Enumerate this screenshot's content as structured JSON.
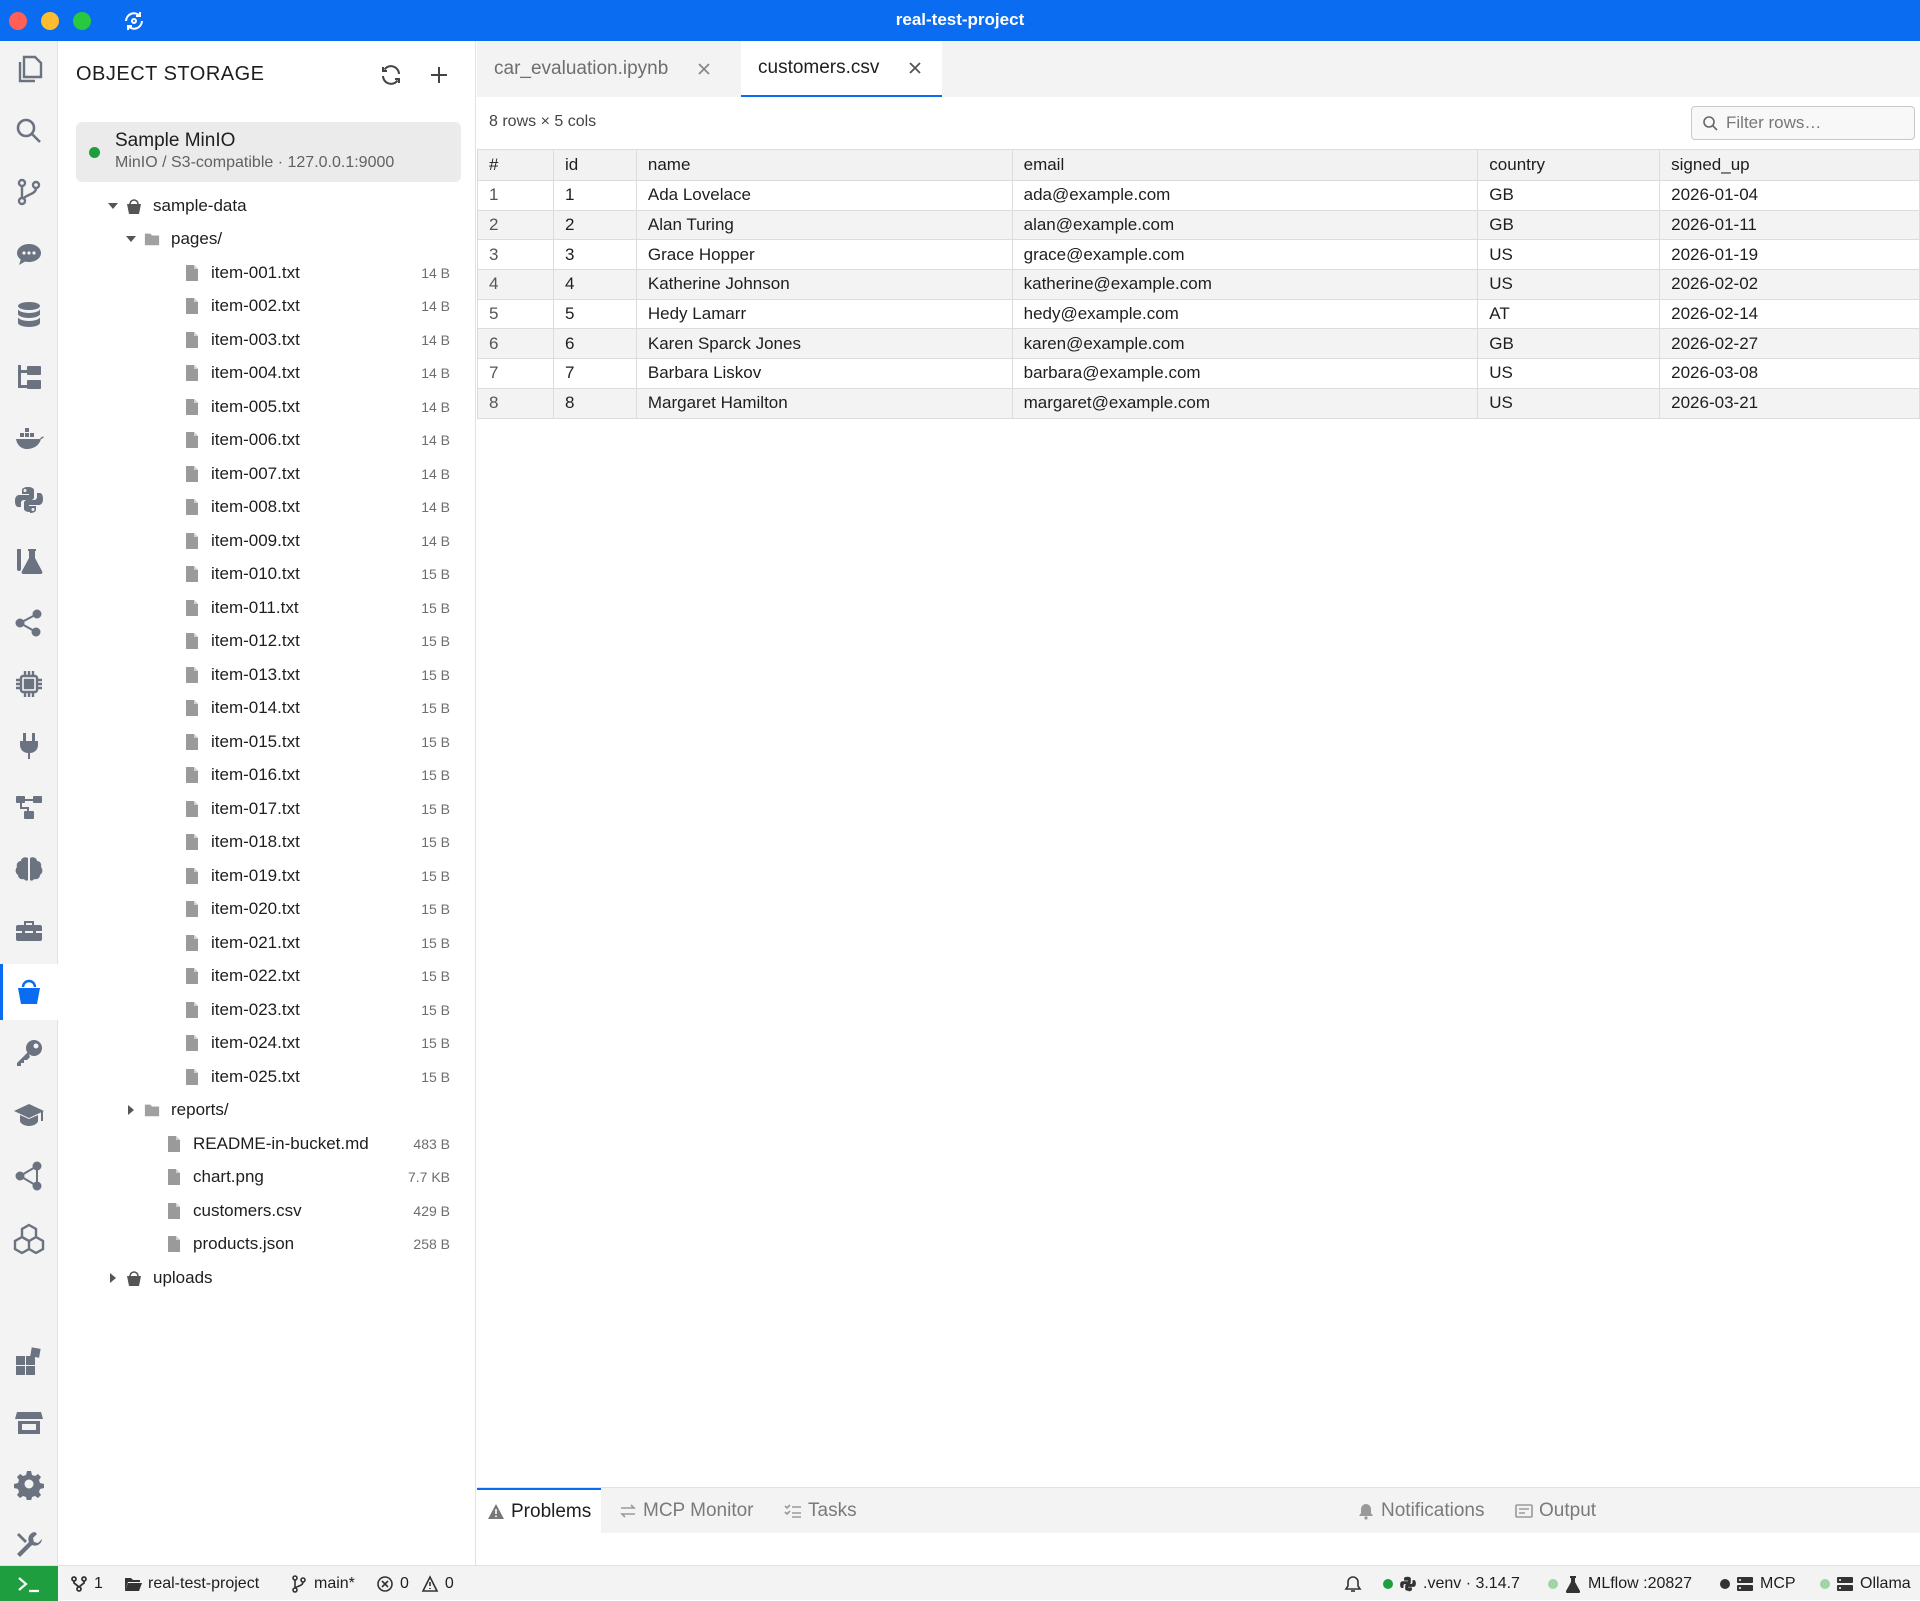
{
  "window": {
    "title": "real-test-project"
  },
  "sidebar": {
    "title": "OBJECT STORAGE",
    "connection": {
      "name": "Sample MinIO",
      "subtitle": "MinIO / S3-compatible · 127.0.0.1:9000",
      "status_color": "#1e9e3e"
    },
    "tree": [
      {
        "name": "sample-data",
        "kind": "bucket",
        "depth": 0,
        "expanded": true
      },
      {
        "name": "pages/",
        "kind": "folder",
        "depth": 1,
        "expanded": true
      },
      {
        "name": "item-001.txt",
        "kind": "file",
        "depth": 2,
        "size": "14 B"
      },
      {
        "name": "item-002.txt",
        "kind": "file",
        "depth": 2,
        "size": "14 B"
      },
      {
        "name": "item-003.txt",
        "kind": "file",
        "depth": 2,
        "size": "14 B"
      },
      {
        "name": "item-004.txt",
        "kind": "file",
        "depth": 2,
        "size": "14 B"
      },
      {
        "name": "item-005.txt",
        "kind": "file",
        "depth": 2,
        "size": "14 B"
      },
      {
        "name": "item-006.txt",
        "kind": "file",
        "depth": 2,
        "size": "14 B"
      },
      {
        "name": "item-007.txt",
        "kind": "file",
        "depth": 2,
        "size": "14 B"
      },
      {
        "name": "item-008.txt",
        "kind": "file",
        "depth": 2,
        "size": "14 B"
      },
      {
        "name": "item-009.txt",
        "kind": "file",
        "depth": 2,
        "size": "14 B"
      },
      {
        "name": "item-010.txt",
        "kind": "file",
        "depth": 2,
        "size": "15 B"
      },
      {
        "name": "item-011.txt",
        "kind": "file",
        "depth": 2,
        "size": "15 B"
      },
      {
        "name": "item-012.txt",
        "kind": "file",
        "depth": 2,
        "size": "15 B"
      },
      {
        "name": "item-013.txt",
        "kind": "file",
        "depth": 2,
        "size": "15 B"
      },
      {
        "name": "item-014.txt",
        "kind": "file",
        "depth": 2,
        "size": "15 B"
      },
      {
        "name": "item-015.txt",
        "kind": "file",
        "depth": 2,
        "size": "15 B"
      },
      {
        "name": "item-016.txt",
        "kind": "file",
        "depth": 2,
        "size": "15 B"
      },
      {
        "name": "item-017.txt",
        "kind": "file",
        "depth": 2,
        "size": "15 B"
      },
      {
        "name": "item-018.txt",
        "kind": "file",
        "depth": 2,
        "size": "15 B"
      },
      {
        "name": "item-019.txt",
        "kind": "file",
        "depth": 2,
        "size": "15 B"
      },
      {
        "name": "item-020.txt",
        "kind": "file",
        "depth": 2,
        "size": "15 B"
      },
      {
        "name": "item-021.txt",
        "kind": "file",
        "depth": 2,
        "size": "15 B"
      },
      {
        "name": "item-022.txt",
        "kind": "file",
        "depth": 2,
        "size": "15 B"
      },
      {
        "name": "item-023.txt",
        "kind": "file",
        "depth": 2,
        "size": "15 B"
      },
      {
        "name": "item-024.txt",
        "kind": "file",
        "depth": 2,
        "size": "15 B"
      },
      {
        "name": "item-025.txt",
        "kind": "file",
        "depth": 2,
        "size": "15 B"
      },
      {
        "name": "reports/",
        "kind": "folder",
        "depth": 1,
        "expanded": false
      },
      {
        "name": "README-in-bucket.md",
        "kind": "file",
        "depth": 1,
        "size": "483 B"
      },
      {
        "name": "chart.png",
        "kind": "file",
        "depth": 1,
        "size": "7.7 KB"
      },
      {
        "name": "customers.csv",
        "kind": "file",
        "depth": 1,
        "size": "429 B"
      },
      {
        "name": "products.json",
        "kind": "file",
        "depth": 1,
        "size": "258 B"
      },
      {
        "name": "uploads",
        "kind": "bucket",
        "depth": 0,
        "expanded": false
      }
    ]
  },
  "tabs": [
    {
      "label": "car_evaluation.ipynb",
      "active": false
    },
    {
      "label": "customers.csv",
      "active": true
    }
  ],
  "editor": {
    "summary": "8 rows × 5 cols",
    "filter_placeholder": "Filter rows…",
    "columns": [
      "#",
      "id",
      "name",
      "email",
      "country",
      "signed_up"
    ],
    "rows": [
      [
        "1",
        "1",
        "Ada Lovelace",
        "ada@example.com",
        "GB",
        "2026-01-04"
      ],
      [
        "2",
        "2",
        "Alan Turing",
        "alan@example.com",
        "GB",
        "2026-01-11"
      ],
      [
        "3",
        "3",
        "Grace Hopper",
        "grace@example.com",
        "US",
        "2026-01-19"
      ],
      [
        "4",
        "4",
        "Katherine Johnson",
        "katherine@example.com",
        "US",
        "2026-02-02"
      ],
      [
        "5",
        "5",
        "Hedy Lamarr",
        "hedy@example.com",
        "AT",
        "2026-02-14"
      ],
      [
        "6",
        "6",
        "Karen Sparck Jones",
        "karen@example.com",
        "GB",
        "2026-02-27"
      ],
      [
        "7",
        "7",
        "Barbara Liskov",
        "barbara@example.com",
        "US",
        "2026-03-08"
      ],
      [
        "8",
        "8",
        "Margaret Hamilton",
        "margaret@example.com",
        "US",
        "2026-03-21"
      ]
    ]
  },
  "panel": {
    "tabs": [
      {
        "label": "Problems",
        "icon": "warning-icon",
        "active": true
      },
      {
        "label": "MCP Monitor",
        "icon": "arrows-icon",
        "active": false
      },
      {
        "label": "Tasks",
        "icon": "tasks-icon",
        "active": false
      },
      {
        "label": "Notifications",
        "icon": "bell-icon",
        "active": false
      },
      {
        "label": "Output",
        "icon": "output-icon",
        "active": false
      }
    ]
  },
  "statusbar": {
    "ports": "1",
    "project": "real-test-project",
    "branch": "main*",
    "errors": "0",
    "warnings": "0",
    "python": ".venv · 3.14.7",
    "mlflow": "MLflow :20827",
    "mcp": "MCP",
    "ollama": "Ollama"
  },
  "colors": {
    "accent": "#0a6cf0",
    "ok": "#1e9e3e"
  }
}
